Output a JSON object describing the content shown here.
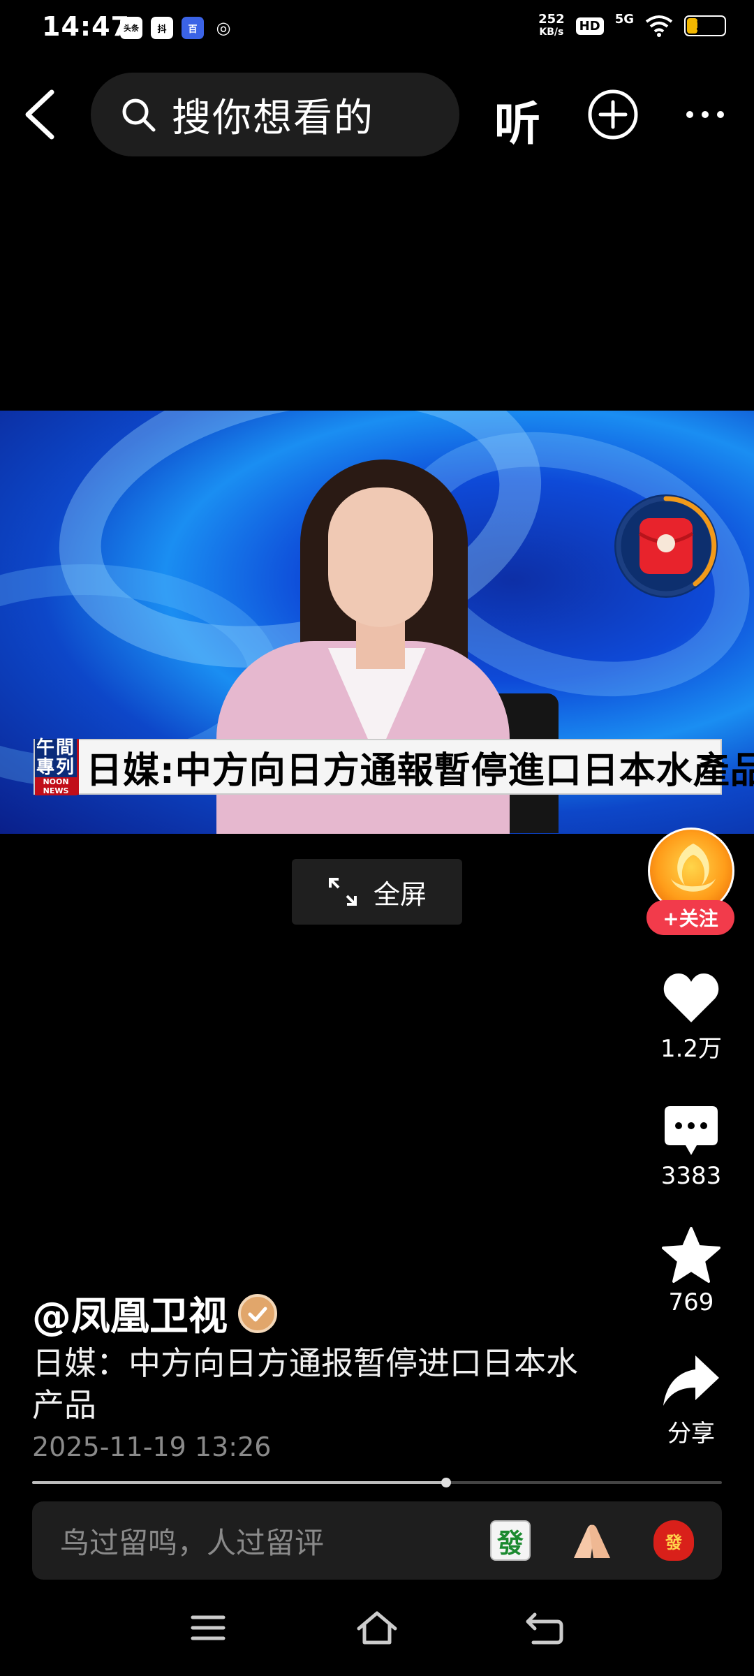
{
  "status_bar": {
    "time": "14:47",
    "app_icons": [
      "头条",
      "抖",
      "百",
      "◎"
    ],
    "net_speed_value": "252",
    "net_speed_unit": "KB/s",
    "hd": "HD",
    "network": "5G",
    "battery": "34",
    "battery_level": 0.34
  },
  "top_nav": {
    "search_placeholder": "搜你想看的",
    "listen_label": "听"
  },
  "video": {
    "banner_logo_cn": "午間專列",
    "banner_logo_en": "NOON NEWS",
    "banner_headline": "日媒:中方向日方通報暫停進口日本水產品",
    "fullscreen_label": "全屏"
  },
  "side_actions": {
    "follow_label": "+关注",
    "like_count": "1.2万",
    "comment_count": "3383",
    "favorite_count": "769",
    "share_label": "分享"
  },
  "post": {
    "author": "@凤凰卫视",
    "caption": "日媒：中方向日方通报暂停进口日本水产品",
    "timestamp": "2025-11-19 13:26",
    "progress": 0.6
  },
  "comment_bar": {
    "placeholder": "鸟过留鸣，人过留评",
    "emoji_fa": "發",
    "emoji_bag": "發"
  },
  "colors": {
    "background": "#000000",
    "follow_red": "#f23b4b",
    "battery_yellow": "#f2b700"
  },
  "icons": [
    "back-arrow-icon",
    "search-icon",
    "plus-circle-icon",
    "more-icon",
    "fullscreen-icon",
    "heart-icon",
    "comment-icon",
    "star-icon",
    "share-icon",
    "menu-icon",
    "home-icon",
    "return-icon"
  ]
}
